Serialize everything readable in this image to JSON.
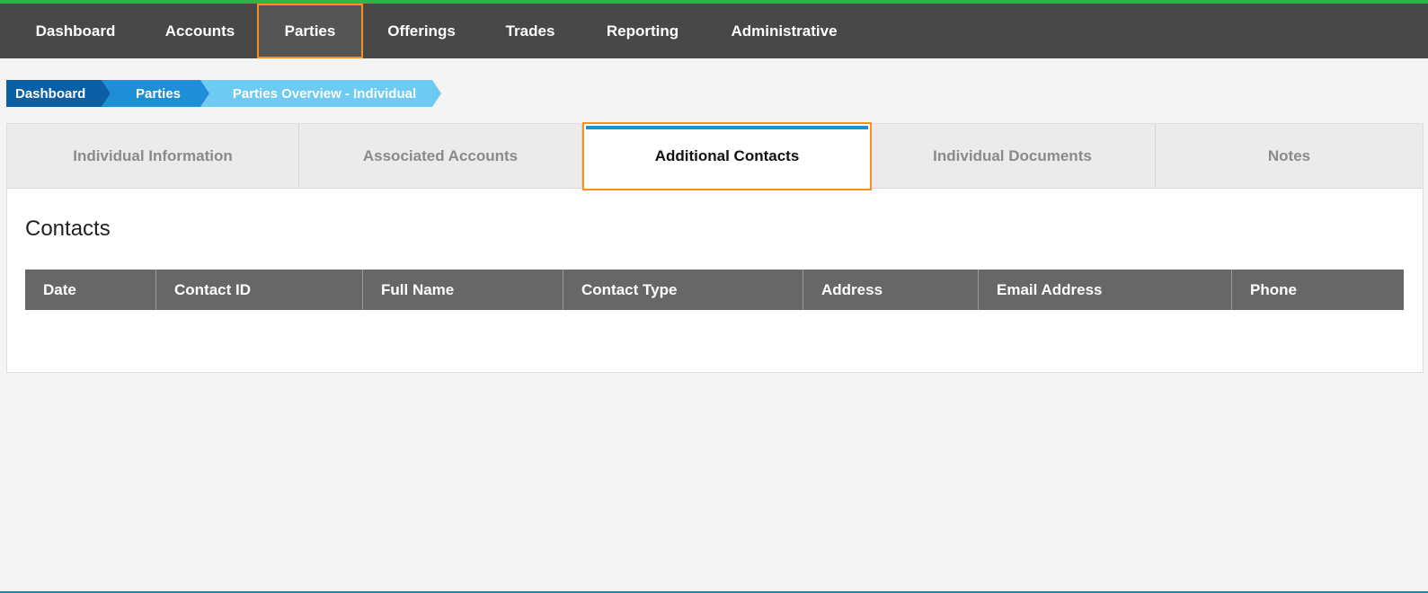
{
  "topnav": {
    "items": [
      {
        "label": "Dashboard",
        "active": false
      },
      {
        "label": "Accounts",
        "active": false
      },
      {
        "label": "Parties",
        "active": true
      },
      {
        "label": "Offerings",
        "active": false
      },
      {
        "label": "Trades",
        "active": false
      },
      {
        "label": "Reporting",
        "active": false
      },
      {
        "label": "Administrative",
        "active": false
      }
    ]
  },
  "breadcrumb": [
    "Dashboard",
    "Parties",
    "Parties Overview - Individual"
  ],
  "tabs": [
    {
      "label": "Individual Information",
      "active": false
    },
    {
      "label": "Associated Accounts",
      "active": false
    },
    {
      "label": "Additional Contacts",
      "active": true
    },
    {
      "label": "Individual Documents",
      "active": false
    },
    {
      "label": "Notes",
      "active": false
    }
  ],
  "contacts": {
    "title": "Contacts",
    "columns": [
      "Date",
      "Contact ID",
      "Full Name",
      "Contact Type",
      "Address",
      "Email Address",
      "Phone"
    ],
    "rows": []
  },
  "colors": {
    "topnav_bg": "#484848",
    "accent_green": "#2fb44a",
    "highlight_orange": "#f7921e",
    "crumb_dark": "#0b5fa5",
    "crumb_mid": "#1e8fd6",
    "crumb_light": "#6dcbf3",
    "table_header": "#676767"
  }
}
